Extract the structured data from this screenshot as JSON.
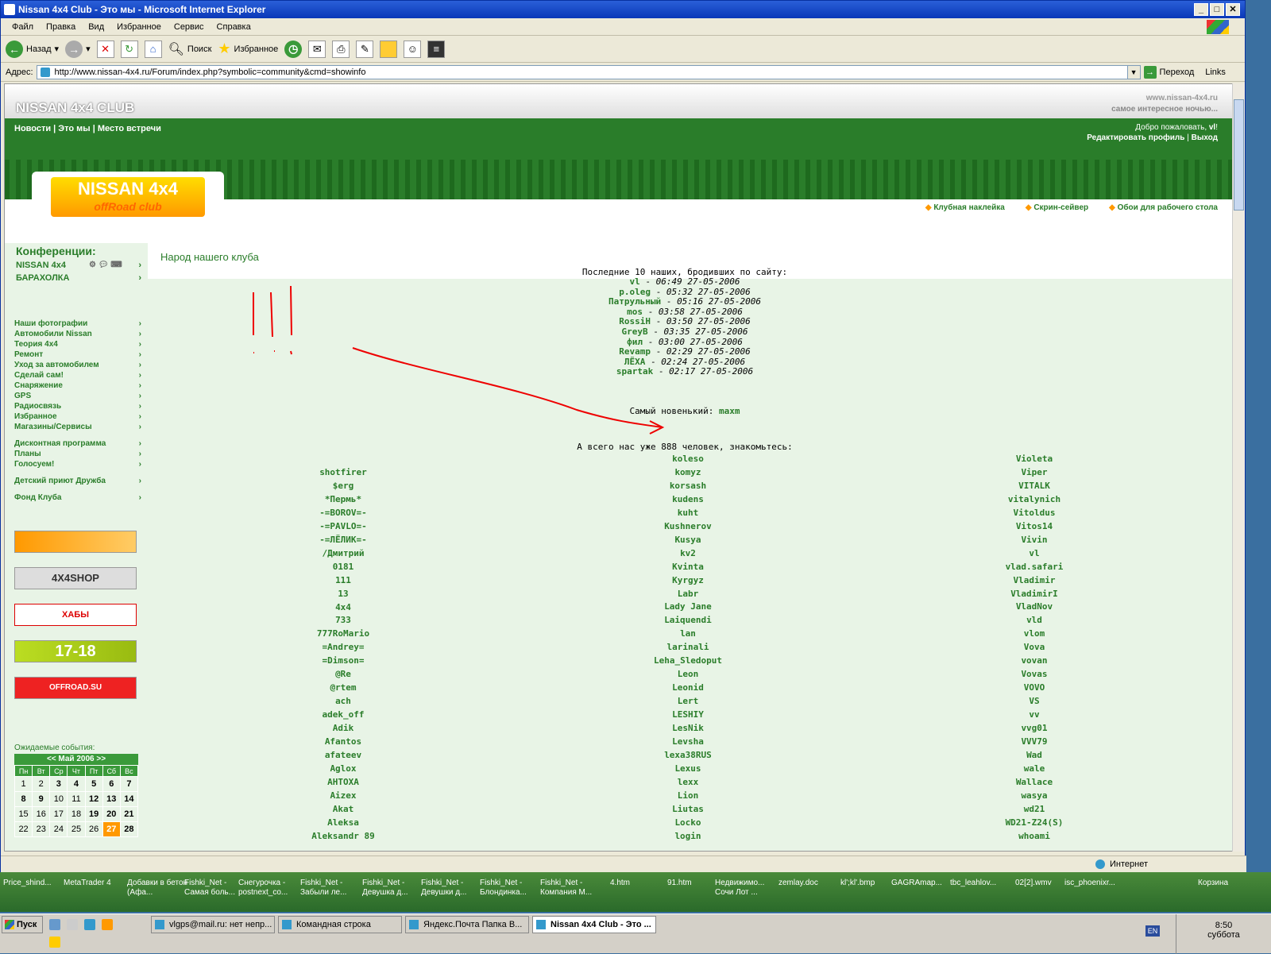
{
  "window": {
    "title": "Nissan 4x4 Club - Это мы - Microsoft Internet Explorer"
  },
  "menu": [
    "Файл",
    "Правка",
    "Вид",
    "Избранное",
    "Сервис",
    "Справка"
  ],
  "toolbar": {
    "back": "Назад",
    "search": "Поиск",
    "favorites": "Избранное"
  },
  "address": {
    "label": "Адрес:",
    "url": "http://www.nissan-4x4.ru/Forum/index.php?symbolic=community&cmd=showinfo",
    "go": "Переход",
    "links": "Links"
  },
  "header": {
    "club": "NISSAN 4x4 CLUB",
    "site": "www.nissan-4x4.ru",
    "slogan": "самое интересное ночью...",
    "nav": "Новости | Это мы | Место встречи",
    "welcome": "Добро пожаловать,",
    "user": "vl",
    "edit_profile": "Редактировать профиль",
    "logout": "Выход",
    "logo_main": "NISSAN 4x4",
    "logo_sub": "offRoad club",
    "link1": "Клубная наклейка",
    "link2": "Скрин-сейвер",
    "link3": "Обои для рабочего стола"
  },
  "sidebar": {
    "conf_title": "Конференции:",
    "conf1": "NISSAN 4x4",
    "conf2": "БАРАХОЛКА",
    "menu": [
      "Наши фотографии",
      "Автомобили Nissan",
      "Теория 4х4",
      "Ремонт",
      "Уход за автомобилем",
      "Сделай сам!",
      "Снаряжение",
      "GPS",
      "Радиосвязь",
      "Избранное",
      "Магазины/Сервисы",
      "Дисконтная программа",
      "Планы",
      "Голосуем!",
      "Детский приют Дружба",
      "Фонд Клуба"
    ],
    "banner2": "4X4SHOP",
    "banner3": "ХАБЫ",
    "banner4": "17-18",
    "banner5": "OFFROAD.SU",
    "events": "Ожидаемые события:",
    "month": "Май 2006",
    "days_header": [
      "Пн",
      "Вт",
      "Ср",
      "Чт",
      "Пт",
      "Сб",
      "Вс"
    ],
    "weeks": [
      [
        "1",
        "2",
        "3",
        "4",
        "5",
        "6",
        "7"
      ],
      [
        "8",
        "9",
        "10",
        "11",
        "12",
        "13",
        "14"
      ],
      [
        "15",
        "16",
        "17",
        "18",
        "19",
        "20",
        "21"
      ],
      [
        "22",
        "23",
        "24",
        "25",
        "26",
        "27",
        "28"
      ]
    ]
  },
  "main": {
    "title": "Народ нашего клуба",
    "last_title": "Последние 10 наших, бродивших по сайту:",
    "recent": [
      [
        "vl",
        "06:49 27-05-2006"
      ],
      [
        "p.oleg",
        "05:32 27-05-2006"
      ],
      [
        "Патрульный",
        "05:16 27-05-2006"
      ],
      [
        "mos",
        "03:58 27-05-2006"
      ],
      [
        "RossiH",
        "03:50 27-05-2006"
      ],
      [
        "GreyB",
        "03:35 27-05-2006"
      ],
      [
        "фил",
        "03:00 27-05-2006"
      ],
      [
        "Revamp",
        "02:29 27-05-2006"
      ],
      [
        "ЛЁХА",
        "02:24 27-05-2006"
      ],
      [
        "spartak",
        "02:17 27-05-2006"
      ]
    ],
    "newest_label": "Самый новенький:",
    "newest": "maxm",
    "total": "А всего нас уже 888 человек, знакомьтесь:",
    "col1": [
      "shotfirer",
      "$erg",
      "*Пермь*",
      "-=BOROV=-",
      "-=PAVLO=-",
      "-=ЛЁЛИК=-",
      "/Дмитрий",
      "0181",
      "111",
      "13",
      "4x4",
      "733",
      "777RoMario",
      "=Andrey=",
      "=Dimson=",
      "@Re",
      "@rtem",
      "ach",
      "adek_off",
      "Adik",
      "Afantos",
      "afateev",
      "Aglox",
      "AHTOXA",
      "Aizex",
      "Akat",
      "Aleksa",
      "Aleksandr 89"
    ],
    "col2": [
      "koleso",
      "komyz",
      "korsash",
      "kudens",
      "kuht",
      "Kushnerov",
      "Kusya",
      "kv2",
      "Kvinta",
      "Kyrgyz",
      "Labr",
      "Lady Jane",
      "Laiquendi",
      "lan",
      "larinali",
      "Leha_Sledoput",
      "Leon",
      "Leonid",
      "Lert",
      "LESHIY",
      "LesNik",
      "Levsha",
      "lexa38RUS",
      "Lexus",
      "lexx",
      "Lion",
      "Liutas",
      "Locko",
      "login"
    ],
    "col3": [
      "Violeta",
      "Viper",
      "VITALK",
      "vitalynich",
      "Vitoldus",
      "Vitos14",
      "Vivin",
      "vl",
      "vlad.safari",
      "Vladimir",
      "VladimirI",
      "VladNov",
      "vld",
      "vlom",
      "Vova",
      "vovan",
      "Vovas",
      "VOVO",
      "VS",
      "vv",
      "vvg01",
      "VVV79",
      "Wad",
      "wale",
      "Wallace",
      "wasya",
      "wd21",
      "WD21-Z24(S)",
      "whoami"
    ]
  },
  "status": {
    "zone": "Интернет"
  },
  "desktop": [
    "Price_shind...",
    "MetaTrader 4",
    "Добавки в бетон (Афа...",
    "Fishki_Net - Самая боль...",
    "Снегурочка - postnext_co...",
    "Fishki_Net - Забыли ле...",
    "Fishki_Net - Девушка д...",
    "Fishki_Net - Девушки д...",
    "Fishki_Net - Блондинка...",
    "Fishki_Net - Компания М...",
    "4.htm",
    "91.htm",
    "Недвижимо... Сочи Лот ...",
    "zemlay.doc",
    "kl';kl'.bmp",
    "GAGRAmap...",
    "tbc_leahlov...",
    "02[2].wmv",
    "isc_phoenixr...",
    "Корзина"
  ],
  "taskbar": {
    "start": "Пуск",
    "t1": "vlgps@mail.ru: нет непр...",
    "t2": "Командная строка",
    "t3": "Яндекс.Почта Папка В...",
    "t4": "Nissan 4x4 Club - Это ...",
    "lang": "EN",
    "time": "8:50",
    "day": "суббота"
  }
}
